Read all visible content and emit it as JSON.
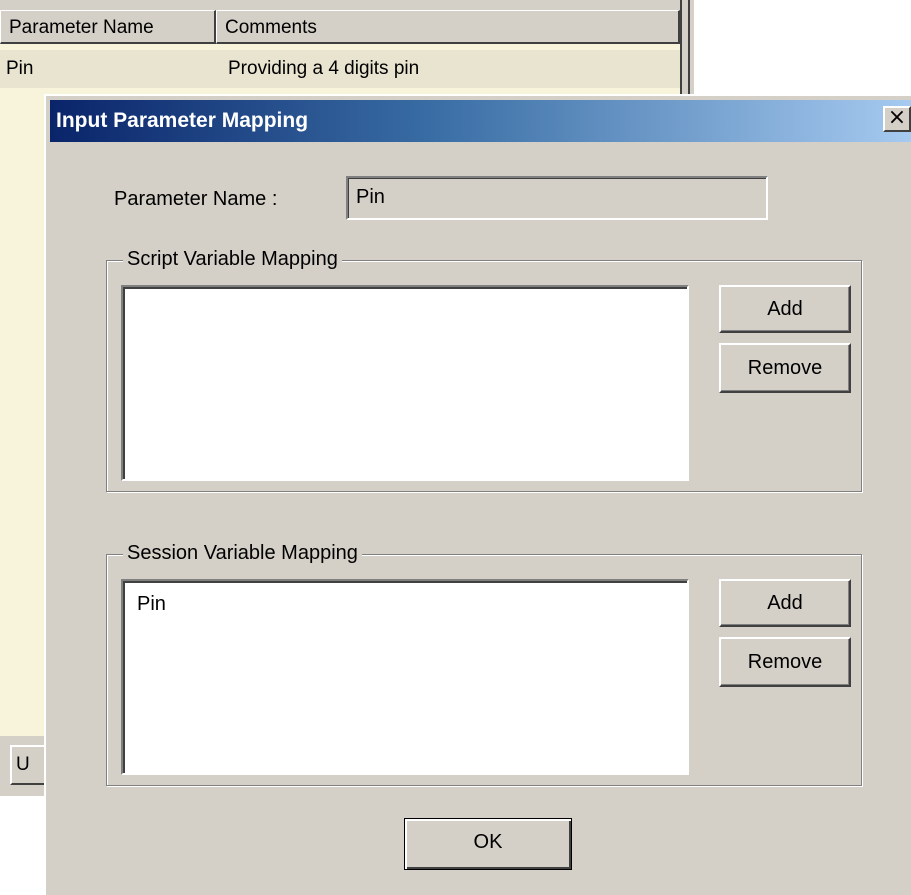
{
  "background_window": {
    "columns": [
      "Parameter Name",
      "Comments"
    ],
    "rows": [
      {
        "name": "Pin",
        "comment": "Providing a 4 digits pin"
      }
    ],
    "bottom_button_label": "U"
  },
  "dialog": {
    "title": "Input Parameter Mapping",
    "close_label": "×",
    "parameter_name_label": "Parameter Name :",
    "parameter_name_value": "Pin",
    "script_group": {
      "legend": "Script Variable Mapping",
      "items": [],
      "add_label": "Add",
      "remove_label": "Remove"
    },
    "session_group": {
      "legend": "Session Variable Mapping",
      "items": [
        "Pin"
      ],
      "add_label": "Add",
      "remove_label": "Remove"
    },
    "ok_label": "OK"
  },
  "colors": {
    "title_gradient_start": "#0a246a",
    "title_gradient_end": "#a6caf0",
    "face": "#d4d0c8",
    "list_background": "#f8f4dc"
  }
}
